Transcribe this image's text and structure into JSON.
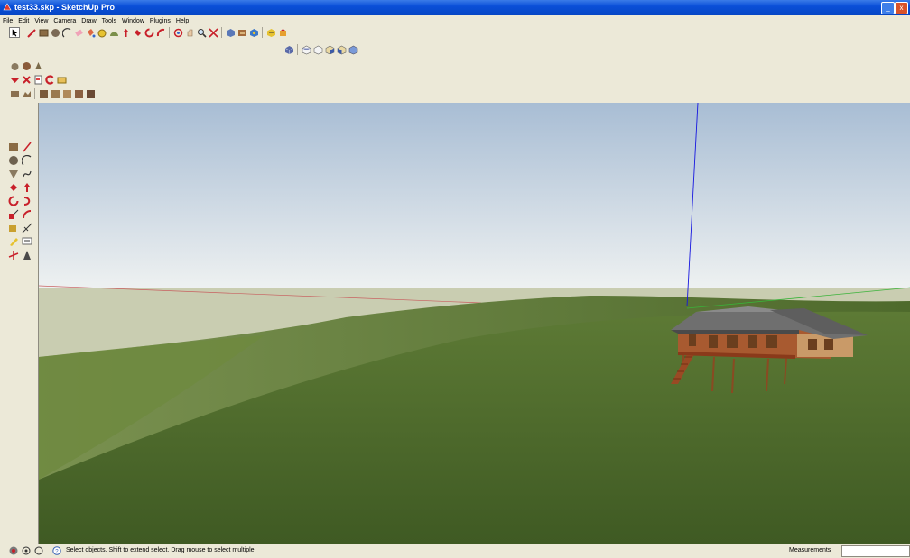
{
  "window": {
    "title": "test33.skp - SketchUp Pro",
    "minimize_label": "_",
    "close_label": "x"
  },
  "menubar": {
    "items": [
      "File",
      "Edit",
      "View",
      "Camera",
      "Draw",
      "Tools",
      "Window",
      "Plugins",
      "Help"
    ]
  },
  "statusbar": {
    "hint": "Select objects. Shift to extend select. Drag mouse to select multiple.",
    "measurements_label": "Measurements",
    "measurements_value": ""
  },
  "colors": {
    "sky_top": "#a8bdd4",
    "sky_bottom": "#eef1f1",
    "ground": "#4f6a2e",
    "haze": "#c9cdb1",
    "axis_blue": "#1717e0",
    "axis_green": "#3ab33a",
    "axis_red": "#c86060",
    "roof": "#6f6f6f",
    "wood": "#a85a30"
  },
  "icons": {
    "main_toolbar": [
      "select-icon",
      "pencil-icon",
      "rectangle-icon",
      "circle-icon",
      "arc-icon",
      "eraser-icon",
      "paint-bucket-icon",
      "tape-measure-icon",
      "protractor-icon",
      "move-icon",
      "rotate-icon",
      "push-pull-icon",
      "follow-me-icon",
      "orbit-icon",
      "pan-icon",
      "zoom-icon",
      "zoom-extents-icon",
      "component-icon",
      "material-icon",
      "section-icon",
      "warehouse-icon",
      "share-icon"
    ],
    "views_toolbar": [
      "iso-view-icon",
      "top-view-icon",
      "front-view-icon",
      "right-view-icon",
      "back-view-icon",
      "left-view-icon"
    ]
  }
}
